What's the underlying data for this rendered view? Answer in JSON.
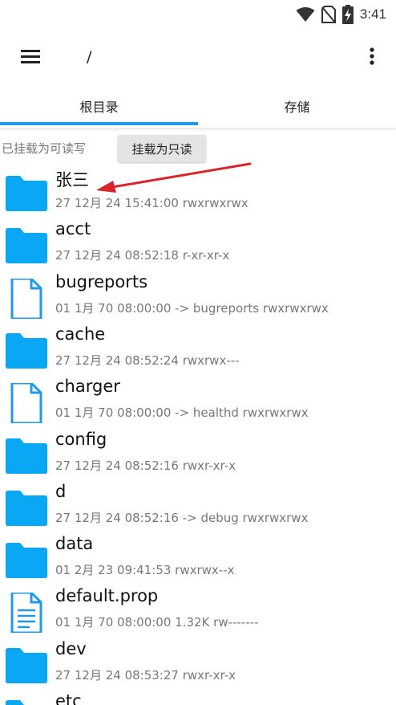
{
  "status_bar": {
    "time": "3:41",
    "icons": [
      "wifi-icon",
      "no-sim-icon",
      "battery-charging-icon"
    ]
  },
  "appbar": {
    "path": "/",
    "menu_icon": "hamburger-menu-icon",
    "more_icon": "more-vert-icon"
  },
  "tabs": [
    {
      "label": "根目录",
      "active": true
    },
    {
      "label": "存储",
      "active": false
    }
  ],
  "accent_color": "#1e9ae8",
  "folder_color": "#0aa7f5",
  "mount": {
    "status": "已挂载为可读写",
    "button_label": "挂载为只读"
  },
  "files": [
    {
      "name": "张三",
      "meta": "27 12月 24 15:41:00   rwxrwxrwx",
      "type": "folder"
    },
    {
      "name": "acct",
      "meta": "27 12月 24 08:52:18   r-xr-xr-x",
      "type": "folder"
    },
    {
      "name": "bugreports",
      "meta": "01 1月 70 08:00:00  -> bugreports  rwxrwxrwx",
      "type": "file"
    },
    {
      "name": "cache",
      "meta": "27 12月 24 08:52:24   rwxrwx---",
      "type": "folder"
    },
    {
      "name": "charger",
      "meta": "01 1月 70 08:00:00  -> healthd  rwxrwxrwx",
      "type": "file"
    },
    {
      "name": "config",
      "meta": "27 12月 24 08:52:16   rwxr-xr-x",
      "type": "folder"
    },
    {
      "name": "d",
      "meta": "27 12月 24 08:52:16  -> debug  rwxrwxrwx",
      "type": "folder"
    },
    {
      "name": "data",
      "meta": "01 2月 23 09:41:53   rwxrwx--x",
      "type": "folder"
    },
    {
      "name": "default.prop",
      "meta": "01 1月 70 08:00:00  1.32K  rw-------",
      "type": "text-file"
    },
    {
      "name": "dev",
      "meta": "27 12月 24 08:53:27   rwxr-xr-x",
      "type": "folder"
    },
    {
      "name": "etc",
      "meta": "",
      "type": "folder"
    }
  ]
}
